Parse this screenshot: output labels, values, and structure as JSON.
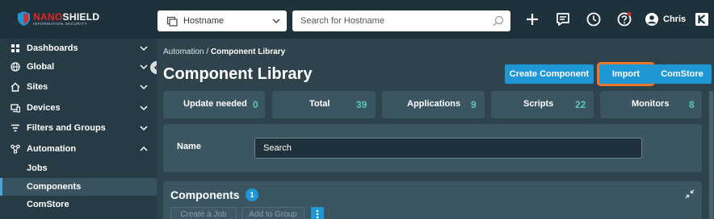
{
  "app": {
    "logo_brand_left": "NANO",
    "logo_brand_right": "SHIELD",
    "logo_subtitle": "INFORMATION SECURITY",
    "brand_colors": {
      "topbar": "#1f323b",
      "sidebar": "#263b44",
      "accent": "#1f97d4",
      "highlight": "#e8762c",
      "stat_value": "#59c6c0"
    }
  },
  "header": {
    "host_select": {
      "value": "Hostname",
      "icon": "document-icon"
    },
    "search": {
      "placeholder": "Search for Hostname",
      "icon": "search-icon"
    },
    "icons": [
      "plus-icon",
      "chat-icon",
      "clock-icon",
      "help-icon"
    ],
    "user": {
      "name": "Chris",
      "icon": "user-avatar-icon"
    },
    "kaseya_icon": "kaseya-logo-icon"
  },
  "sidebar": {
    "items": [
      {
        "label": "Dashboards",
        "icon": "grid-icon",
        "expanded": false
      },
      {
        "label": "Global",
        "icon": "globe-icon",
        "expanded": false
      },
      {
        "label": "Sites",
        "icon": "home-icon",
        "expanded": false
      },
      {
        "label": "Devices",
        "icon": "devices-icon",
        "expanded": false
      },
      {
        "label": "Filters and Groups",
        "icon": "filter-icon",
        "expanded": false
      },
      {
        "label": "Automation",
        "icon": "automation-icon",
        "expanded": true
      }
    ],
    "sub_items": [
      {
        "label": "Jobs",
        "active": false
      },
      {
        "label": "Components",
        "active": true
      },
      {
        "label": "ComStore",
        "active": false
      }
    ]
  },
  "main": {
    "breadcrumb": {
      "parent": "Automation",
      "separator": " / ",
      "current": "Component Library"
    },
    "title": "Component Library",
    "buttons": {
      "create": "Create Component",
      "import": "Import",
      "comstore": "ComStore"
    },
    "stats": [
      {
        "label": "Update needed",
        "value": "0"
      },
      {
        "label": "Total",
        "value": "39"
      },
      {
        "label": "Applications",
        "value": "9"
      },
      {
        "label": "Scripts",
        "value": "22"
      },
      {
        "label": "Monitors",
        "value": "8"
      }
    ],
    "filter": {
      "name_label": "Name",
      "placeholder": "Search"
    },
    "components": {
      "title": "Components",
      "count": "1",
      "create_job": "Create a Job",
      "add_to_group": "Add to Group"
    }
  }
}
